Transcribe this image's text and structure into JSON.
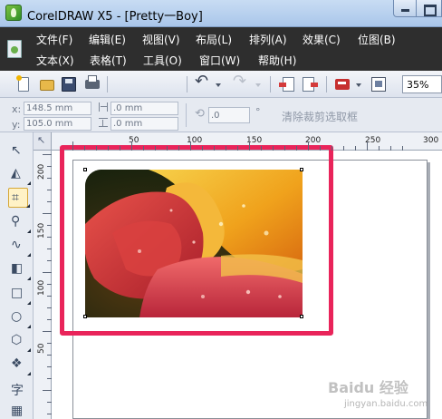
{
  "window": {
    "title": "CorelDRAW X5 - [Pretty一Boy]"
  },
  "menu": {
    "row1": [
      "文件(F)",
      "编辑(E)",
      "视图(V)",
      "布局(L)",
      "排列(A)",
      "效果(C)",
      "位图(B)"
    ],
    "row2": [
      "文本(X)",
      "表格(T)",
      "工具(O)",
      "窗口(W)",
      "帮助(H)"
    ]
  },
  "toolbar": {
    "zoom": "35%",
    "undo_glyph": "↶",
    "redo_glyph": "↷",
    "cut_glyph": "✂",
    "copy_glyph": "⧉",
    "paste_glyph": "▤"
  },
  "property_bar": {
    "x_label": "x:",
    "y_label": "y:",
    "x_value": "148.5 mm",
    "y_value": "105.0 mm",
    "width_value": ".0 mm",
    "height_value": ".0 mm",
    "rotation_value": ".0",
    "degree": "°",
    "clear_crop": "清除裁剪选取框"
  },
  "rulers": {
    "top_labels": [
      "50",
      "100",
      "150",
      "200",
      "250",
      "300"
    ],
    "left_labels": [
      "200",
      "150",
      "100",
      "50"
    ]
  },
  "toolbox": {
    "tools": [
      {
        "name": "pick-tool",
        "glyph": "↖"
      },
      {
        "name": "shape-tool",
        "glyph": "◭"
      },
      {
        "name": "crop-tool",
        "glyph": "⌗"
      },
      {
        "name": "zoom-tool",
        "glyph": "⚲"
      },
      {
        "name": "freehand-tool",
        "glyph": "∿"
      },
      {
        "name": "smart-fill-tool",
        "glyph": "◧"
      },
      {
        "name": "rectangle-tool",
        "glyph": "□"
      },
      {
        "name": "ellipse-tool",
        "glyph": "○"
      },
      {
        "name": "polygon-tool",
        "glyph": "⬡"
      },
      {
        "name": "basic-shapes-tool",
        "glyph": "❖"
      },
      {
        "name": "text-tool",
        "glyph": "字"
      },
      {
        "name": "table-tool",
        "glyph": "▦"
      }
    ]
  },
  "colors": {
    "highlight": "#e9245a",
    "menubar": "#2e2e2e",
    "crop_active": "#fff2c6"
  },
  "watermark": {
    "text": "Baidu 经验",
    "sub": "jingyan.baidu.com"
  }
}
